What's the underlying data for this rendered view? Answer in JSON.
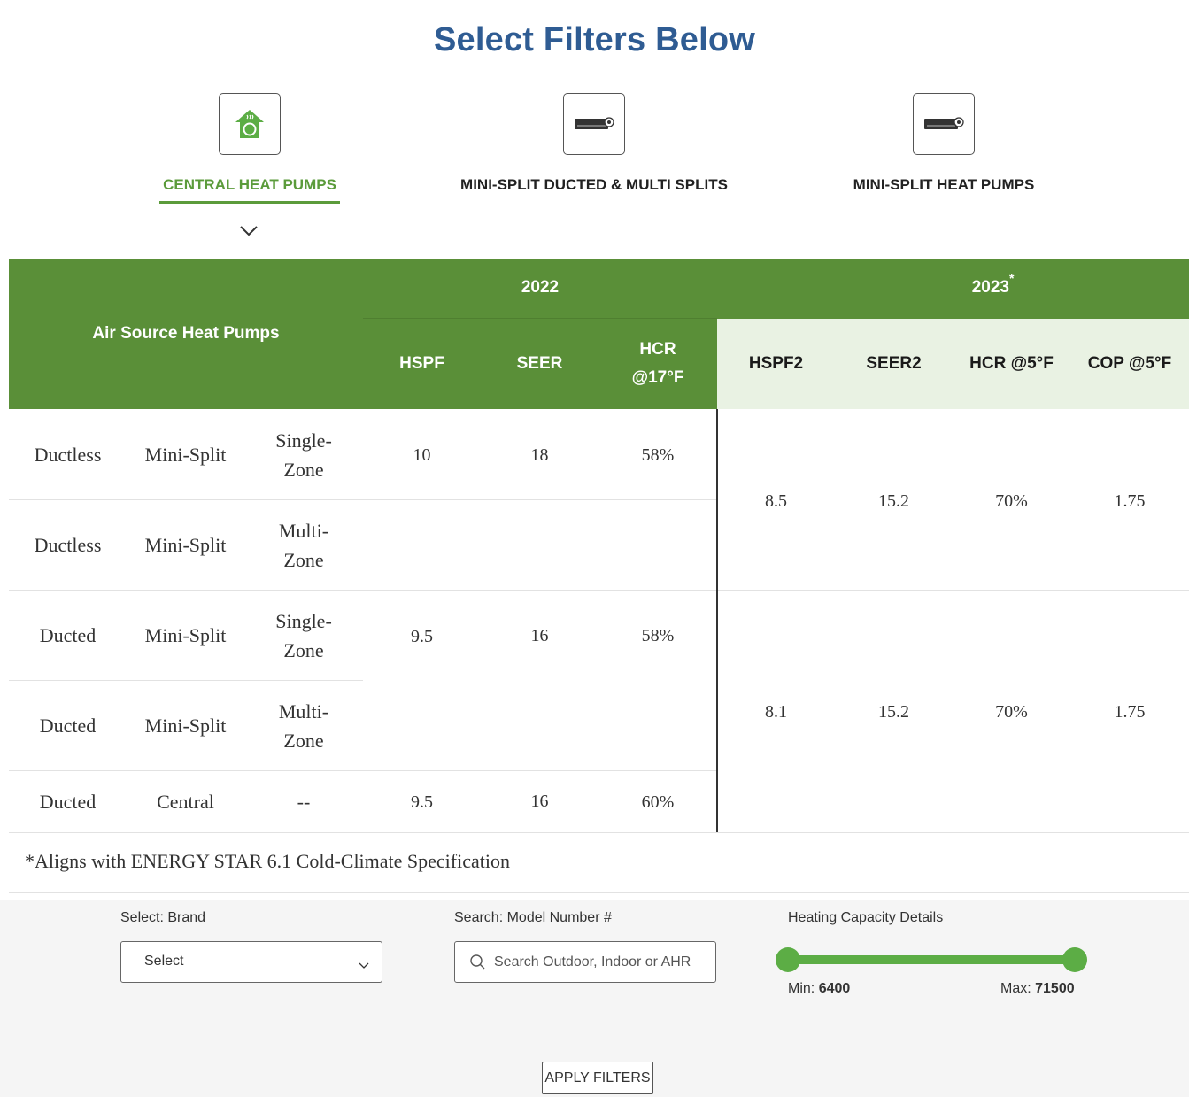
{
  "page": {
    "title": "Select Filters Below"
  },
  "categories": [
    {
      "label": "CENTRAL HEAT PUMPS",
      "icon": "house-heat-pump-icon",
      "active": true
    },
    {
      "label": "MINI-SPLIT DUCTED & MULTI SPLITS",
      "icon": "mini-split-unit-icon",
      "active": false
    },
    {
      "label": "MINI-SPLIT HEAT PUMPS",
      "icon": "mini-split-unit-icon",
      "active": false
    }
  ],
  "colors": {
    "brand_green": "#5a8f38",
    "title_blue": "#2f5c93",
    "light_green": "#e9f2e3",
    "slider_green": "#5cad45"
  },
  "table": {
    "row_header": "Air Source Heat Pumps",
    "group_2022": "2022",
    "group_2023": "2023",
    "group_2023_mark": "*",
    "cols_2022": [
      "HSPF",
      "SEER",
      "HCR",
      "@17°F"
    ],
    "cols_2023": [
      "HSPF2",
      "SEER2",
      "HCR @5°F",
      "COP @5°F"
    ],
    "rows": [
      {
        "type": "Ductless",
        "system": "Mini-Split",
        "zone_1": "Single-",
        "zone_2": "Zone"
      },
      {
        "type": "Ductless",
        "system": "Mini-Split",
        "zone_1": "Multi-",
        "zone_2": "Zone"
      },
      {
        "type": "Ducted",
        "system": "Mini-Split",
        "zone_1": "Single-",
        "zone_2": "Zone"
      },
      {
        "type": "Ducted",
        "system": "Mini-Split",
        "zone_1": "Multi-",
        "zone_2": "Zone"
      },
      {
        "type": "Ducted",
        "system": "Central",
        "zone_1": "--",
        "zone_2": ""
      }
    ],
    "values_2022": [
      {
        "hspf": "10",
        "seer": "18",
        "hcr": "58%"
      },
      {
        "hspf": "9.5",
        "seer": "16",
        "hcr": "58%"
      },
      {
        "hspf": "9.5",
        "seer": "16",
        "hcr": "60%"
      }
    ],
    "values_2023": [
      {
        "hspf2": "8.5",
        "seer2": "15.2",
        "hcr": "70%",
        "cop": "1.75"
      },
      {
        "hspf2": "8.1",
        "seer2": "15.2",
        "hcr": "70%",
        "cop": "1.75"
      }
    ],
    "footnote": "*Aligns with ENERGY STAR 6.1 Cold-Climate Specification"
  },
  "filters": {
    "brand_label": "Select: Brand",
    "brand_value": "Select",
    "model_label": "Search: Model Number #",
    "model_placeholder": "Search Outdoor, Indoor or AHR",
    "capacity_label": "Heating Capacity Details",
    "min_label": "Min:",
    "min_value": "6400",
    "max_label": "Max:",
    "max_value": "71500",
    "apply_label": "APPLY FILTERS"
  }
}
